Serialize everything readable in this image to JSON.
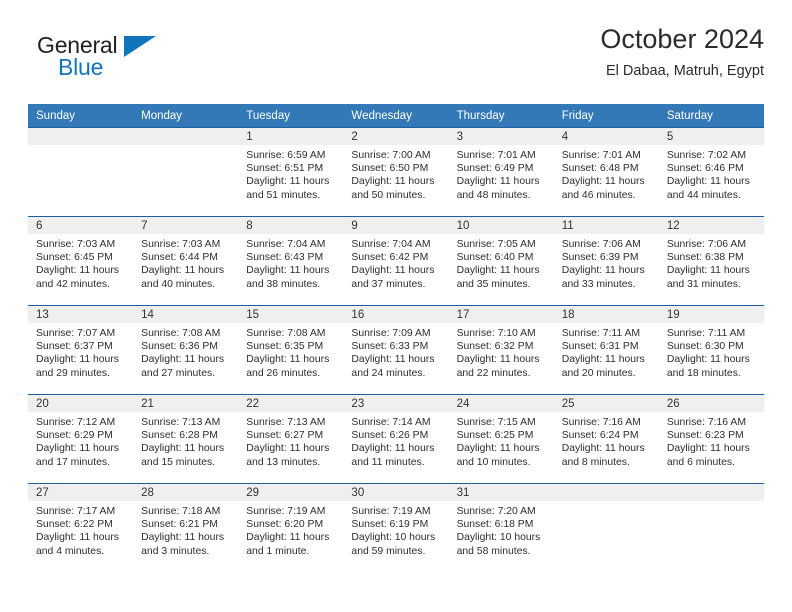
{
  "brand": {
    "name_top": "General",
    "name_bottom": "Blue",
    "triangle_color": "#1175bb",
    "text_color": "#231f20"
  },
  "header": {
    "title": "October 2024",
    "subtitle": "El Dabaa, Matruh, Egypt"
  },
  "colors": {
    "header_row_bg": "#3379b7",
    "header_row_text": "#ffffff",
    "row_divider": "#1e5f9e",
    "daynum_band_bg": "#efefef",
    "cell_text": "#2e2e2e"
  },
  "calendar": {
    "weekday_headers": [
      "Sunday",
      "Monday",
      "Tuesday",
      "Wednesday",
      "Thursday",
      "Friday",
      "Saturday"
    ],
    "weeks": [
      [
        {
          "day": "",
          "sunrise": "",
          "sunset": "",
          "daylight_line1": "",
          "daylight_line2": ""
        },
        {
          "day": "",
          "sunrise": "",
          "sunset": "",
          "daylight_line1": "",
          "daylight_line2": ""
        },
        {
          "day": "1",
          "sunrise": "Sunrise: 6:59 AM",
          "sunset": "Sunset: 6:51 PM",
          "daylight_line1": "Daylight: 11 hours",
          "daylight_line2": "and 51 minutes."
        },
        {
          "day": "2",
          "sunrise": "Sunrise: 7:00 AM",
          "sunset": "Sunset: 6:50 PM",
          "daylight_line1": "Daylight: 11 hours",
          "daylight_line2": "and 50 minutes."
        },
        {
          "day": "3",
          "sunrise": "Sunrise: 7:01 AM",
          "sunset": "Sunset: 6:49 PM",
          "daylight_line1": "Daylight: 11 hours",
          "daylight_line2": "and 48 minutes."
        },
        {
          "day": "4",
          "sunrise": "Sunrise: 7:01 AM",
          "sunset": "Sunset: 6:48 PM",
          "daylight_line1": "Daylight: 11 hours",
          "daylight_line2": "and 46 minutes."
        },
        {
          "day": "5",
          "sunrise": "Sunrise: 7:02 AM",
          "sunset": "Sunset: 6:46 PM",
          "daylight_line1": "Daylight: 11 hours",
          "daylight_line2": "and 44 minutes."
        }
      ],
      [
        {
          "day": "6",
          "sunrise": "Sunrise: 7:03 AM",
          "sunset": "Sunset: 6:45 PM",
          "daylight_line1": "Daylight: 11 hours",
          "daylight_line2": "and 42 minutes."
        },
        {
          "day": "7",
          "sunrise": "Sunrise: 7:03 AM",
          "sunset": "Sunset: 6:44 PM",
          "daylight_line1": "Daylight: 11 hours",
          "daylight_line2": "and 40 minutes."
        },
        {
          "day": "8",
          "sunrise": "Sunrise: 7:04 AM",
          "sunset": "Sunset: 6:43 PM",
          "daylight_line1": "Daylight: 11 hours",
          "daylight_line2": "and 38 minutes."
        },
        {
          "day": "9",
          "sunrise": "Sunrise: 7:04 AM",
          "sunset": "Sunset: 6:42 PM",
          "daylight_line1": "Daylight: 11 hours",
          "daylight_line2": "and 37 minutes."
        },
        {
          "day": "10",
          "sunrise": "Sunrise: 7:05 AM",
          "sunset": "Sunset: 6:40 PM",
          "daylight_line1": "Daylight: 11 hours",
          "daylight_line2": "and 35 minutes."
        },
        {
          "day": "11",
          "sunrise": "Sunrise: 7:06 AM",
          "sunset": "Sunset: 6:39 PM",
          "daylight_line1": "Daylight: 11 hours",
          "daylight_line2": "and 33 minutes."
        },
        {
          "day": "12",
          "sunrise": "Sunrise: 7:06 AM",
          "sunset": "Sunset: 6:38 PM",
          "daylight_line1": "Daylight: 11 hours",
          "daylight_line2": "and 31 minutes."
        }
      ],
      [
        {
          "day": "13",
          "sunrise": "Sunrise: 7:07 AM",
          "sunset": "Sunset: 6:37 PM",
          "daylight_line1": "Daylight: 11 hours",
          "daylight_line2": "and 29 minutes."
        },
        {
          "day": "14",
          "sunrise": "Sunrise: 7:08 AM",
          "sunset": "Sunset: 6:36 PM",
          "daylight_line1": "Daylight: 11 hours",
          "daylight_line2": "and 27 minutes."
        },
        {
          "day": "15",
          "sunrise": "Sunrise: 7:08 AM",
          "sunset": "Sunset: 6:35 PM",
          "daylight_line1": "Daylight: 11 hours",
          "daylight_line2": "and 26 minutes."
        },
        {
          "day": "16",
          "sunrise": "Sunrise: 7:09 AM",
          "sunset": "Sunset: 6:33 PM",
          "daylight_line1": "Daylight: 11 hours",
          "daylight_line2": "and 24 minutes."
        },
        {
          "day": "17",
          "sunrise": "Sunrise: 7:10 AM",
          "sunset": "Sunset: 6:32 PM",
          "daylight_line1": "Daylight: 11 hours",
          "daylight_line2": "and 22 minutes."
        },
        {
          "day": "18",
          "sunrise": "Sunrise: 7:11 AM",
          "sunset": "Sunset: 6:31 PM",
          "daylight_line1": "Daylight: 11 hours",
          "daylight_line2": "and 20 minutes."
        },
        {
          "day": "19",
          "sunrise": "Sunrise: 7:11 AM",
          "sunset": "Sunset: 6:30 PM",
          "daylight_line1": "Daylight: 11 hours",
          "daylight_line2": "and 18 minutes."
        }
      ],
      [
        {
          "day": "20",
          "sunrise": "Sunrise: 7:12 AM",
          "sunset": "Sunset: 6:29 PM",
          "daylight_line1": "Daylight: 11 hours",
          "daylight_line2": "and 17 minutes."
        },
        {
          "day": "21",
          "sunrise": "Sunrise: 7:13 AM",
          "sunset": "Sunset: 6:28 PM",
          "daylight_line1": "Daylight: 11 hours",
          "daylight_line2": "and 15 minutes."
        },
        {
          "day": "22",
          "sunrise": "Sunrise: 7:13 AM",
          "sunset": "Sunset: 6:27 PM",
          "daylight_line1": "Daylight: 11 hours",
          "daylight_line2": "and 13 minutes."
        },
        {
          "day": "23",
          "sunrise": "Sunrise: 7:14 AM",
          "sunset": "Sunset: 6:26 PM",
          "daylight_line1": "Daylight: 11 hours",
          "daylight_line2": "and 11 minutes."
        },
        {
          "day": "24",
          "sunrise": "Sunrise: 7:15 AM",
          "sunset": "Sunset: 6:25 PM",
          "daylight_line1": "Daylight: 11 hours",
          "daylight_line2": "and 10 minutes."
        },
        {
          "day": "25",
          "sunrise": "Sunrise: 7:16 AM",
          "sunset": "Sunset: 6:24 PM",
          "daylight_line1": "Daylight: 11 hours",
          "daylight_line2": "and 8 minutes."
        },
        {
          "day": "26",
          "sunrise": "Sunrise: 7:16 AM",
          "sunset": "Sunset: 6:23 PM",
          "daylight_line1": "Daylight: 11 hours",
          "daylight_line2": "and 6 minutes."
        }
      ],
      [
        {
          "day": "27",
          "sunrise": "Sunrise: 7:17 AM",
          "sunset": "Sunset: 6:22 PM",
          "daylight_line1": "Daylight: 11 hours",
          "daylight_line2": "and 4 minutes."
        },
        {
          "day": "28",
          "sunrise": "Sunrise: 7:18 AM",
          "sunset": "Sunset: 6:21 PM",
          "daylight_line1": "Daylight: 11 hours",
          "daylight_line2": "and 3 minutes."
        },
        {
          "day": "29",
          "sunrise": "Sunrise: 7:19 AM",
          "sunset": "Sunset: 6:20 PM",
          "daylight_line1": "Daylight: 11 hours",
          "daylight_line2": "and 1 minute."
        },
        {
          "day": "30",
          "sunrise": "Sunrise: 7:19 AM",
          "sunset": "Sunset: 6:19 PM",
          "daylight_line1": "Daylight: 10 hours",
          "daylight_line2": "and 59 minutes."
        },
        {
          "day": "31",
          "sunrise": "Sunrise: 7:20 AM",
          "sunset": "Sunset: 6:18 PM",
          "daylight_line1": "Daylight: 10 hours",
          "daylight_line2": "and 58 minutes."
        },
        {
          "day": "",
          "sunrise": "",
          "sunset": "",
          "daylight_line1": "",
          "daylight_line2": ""
        },
        {
          "day": "",
          "sunrise": "",
          "sunset": "",
          "daylight_line1": "",
          "daylight_line2": ""
        }
      ]
    ]
  }
}
